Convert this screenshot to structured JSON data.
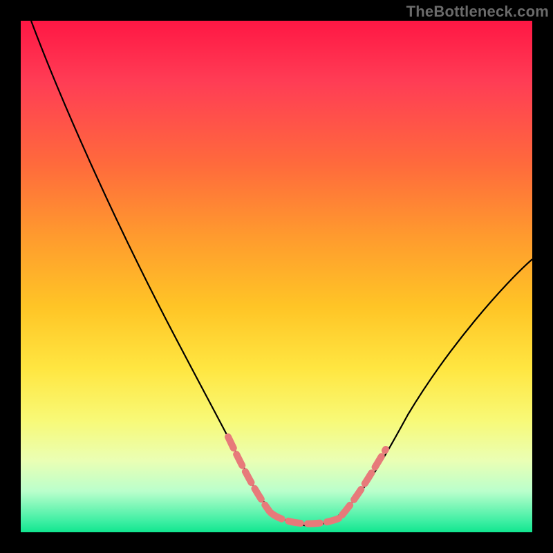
{
  "watermark": "TheBottleneck.com",
  "colors": {
    "background": "#000000",
    "curve": "#000000",
    "dashed_marker": "#e77a7a"
  },
  "chart_data": {
    "type": "line",
    "title": "",
    "xlabel": "",
    "ylabel": "",
    "xlim": [
      0,
      100
    ],
    "ylim": [
      0,
      100
    ],
    "grid": false,
    "legend": false,
    "series": [
      {
        "name": "curve",
        "x": [
          2,
          10,
          20,
          28,
          35,
          40,
          45,
          50,
          55,
          60,
          65,
          70,
          80,
          90,
          100
        ],
        "values": [
          100,
          85,
          67,
          52,
          38,
          26,
          14,
          6,
          2,
          2,
          6,
          14,
          30,
          42,
          53
        ]
      }
    ],
    "highlighted_ranges": [
      {
        "name": "left-dashed-marker",
        "x_start": 40,
        "x_end": 50
      },
      {
        "name": "flat-dashed-marker",
        "x_start": 50,
        "x_end": 62
      },
      {
        "name": "right-dashed-marker",
        "x_start": 62,
        "x_end": 70
      }
    ],
    "note": "Values estimated from pixel positions; no axis tick labels present in image."
  }
}
